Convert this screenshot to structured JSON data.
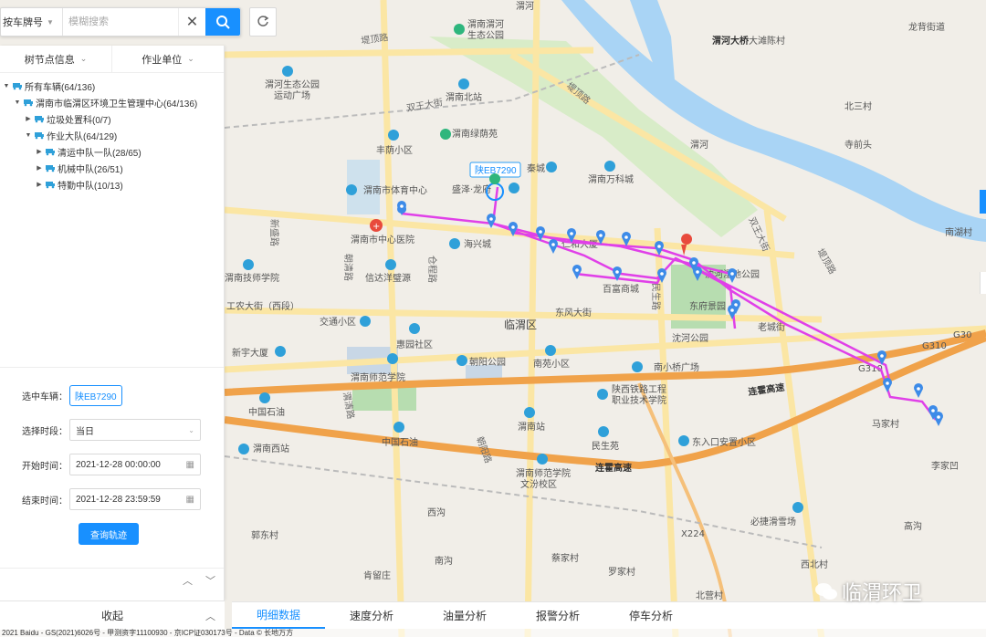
{
  "search": {
    "type_label": "按车牌号",
    "placeholder": "模糊搜索"
  },
  "panel": {
    "tabs": [
      "树节点信息",
      "作业单位"
    ],
    "tree": [
      {
        "label": "所有车辆(64/136)",
        "level": 0,
        "expanded": true
      },
      {
        "label": "渭南市临渭区环境卫生管理中心(64/136)",
        "level": 1,
        "expanded": true
      },
      {
        "label": "垃圾处置科(0/7)",
        "level": 2,
        "expanded": false
      },
      {
        "label": "作业大队(64/129)",
        "level": 2,
        "expanded": true
      },
      {
        "label": "清运中队一队(28/65)",
        "level": 3,
        "expanded": false
      },
      {
        "label": "机械中队(26/51)",
        "level": 3,
        "expanded": false
      },
      {
        "label": "特勤中队(10/13)",
        "level": 3,
        "expanded": false
      }
    ],
    "form": {
      "vehicle_label": "选中车辆：",
      "vehicle_value": "陕EB7290",
      "period_label": "选择时段：",
      "period_value": "当日",
      "start_label": "开始时间：",
      "start_value": "2021-12-28 00:00:00",
      "end_label": "结束时间：",
      "end_value": "2021-12-28 23:59:59",
      "query_label": "查询轨迹"
    },
    "collapse_label": "收起"
  },
  "bottom_tabs": [
    "明细数据",
    "速度分析",
    "油量分析",
    "报警分析",
    "停车分析"
  ],
  "map": {
    "vehicle_callout": "陕EB7290",
    "labels": [
      "渭河",
      "渭南渭河生态公园",
      "堤顶路",
      "渭河大桥",
      "大滩陈村",
      "龙背街道",
      "渭河生态公园运动广场",
      "渭南北站",
      "堤顶路",
      "北三村",
      "双王大街",
      "丰荫小区",
      "渭南绿荫苑",
      "渭河",
      "寺前头",
      "秦城",
      "渭南万科城",
      "渭南市体育中心",
      "盛泽·龙府",
      "双王大街",
      "南湖村",
      "新盛路",
      "渭南市中心医院",
      "海兴城",
      "仁和大厦",
      "沈河湿地公园",
      "堤顶路",
      "渭南技师学院",
      "信达洋璧源",
      "仓程路",
      "百富商城",
      "民生路",
      "东府景园",
      "朝清路",
      "工农大街（西段）",
      "东风大街",
      "临渭区",
      "老城街",
      "交通小区",
      "惠园社区",
      "沈河公园",
      "新宇大厦",
      "朝阳公园",
      "南苑小区",
      "南小桥广场",
      "G310",
      "渭南师范学院",
      "陕西铁路工程职业技术学院",
      "连霍高速",
      "马家村",
      "中国石油",
      "渭清路",
      "渭南站",
      "中国石油",
      "民生苑",
      "东入口安置小区",
      "渭南西站",
      "渭南师范学院文汾校区",
      "连霍高速",
      "李家凹",
      "郭东村",
      "西沟",
      "必捷滑雪场",
      "高沟",
      "蔡家村",
      "罗家村",
      "南沟",
      "肯留庄",
      "西北村",
      "北营村",
      "G30",
      "G310",
      "X224"
    ]
  },
  "copyright": "2021 Baidu - GS(2021)6026号 - 甲测资字11100930 - 京ICP证030173号 - Data © 长地万方",
  "watermark": "临渭环卫",
  "colors": {
    "accent": "#1890ff",
    "track": "#e040e8",
    "marker": "#3d8be8",
    "river": "#a9d4f5",
    "highway": "#f0a24a"
  }
}
